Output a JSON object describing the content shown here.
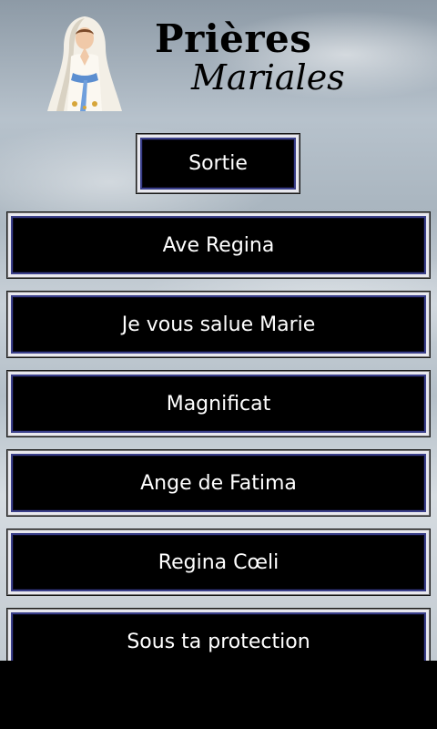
{
  "header": {
    "title_line1": "Prières",
    "title_line2": "Mariales"
  },
  "actions": {
    "exit_label": "Sortie"
  },
  "prayers": [
    {
      "label": "Ave Regina"
    },
    {
      "label": "Je vous salue Marie"
    },
    {
      "label": "Magnificat"
    },
    {
      "label": "Ange de Fatima"
    },
    {
      "label": "Regina Cœli"
    },
    {
      "label": "Sous ta protection"
    }
  ]
}
